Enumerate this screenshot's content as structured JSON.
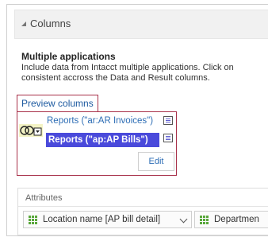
{
  "section": {
    "title": "Columns"
  },
  "multiple_applications": {
    "title": "Multiple applications",
    "description_line1": "Include data from Intacct multiple applications. Click on",
    "description_line2": "consistent accross the Data and Result columns."
  },
  "preview_link": "Preview columns",
  "sources": [
    {
      "label": "Reports (\"ar:AR Invoices\")",
      "selected": false
    },
    {
      "label": "Reports (\"ap:AP Bills\")",
      "selected": true
    }
  ],
  "edit_button": "Edit",
  "attributes": {
    "label": "Attributes",
    "fields": [
      {
        "label": "Location name [AP bill detail]",
        "icon": "grid-icon"
      },
      {
        "label": "Departmen",
        "icon": "grid-icon"
      }
    ]
  },
  "colors": {
    "selected_row": "#4a4adb",
    "link": "#2d6db5",
    "highlight_border": "#a8314a",
    "grid_icon": "#5aa83c"
  }
}
